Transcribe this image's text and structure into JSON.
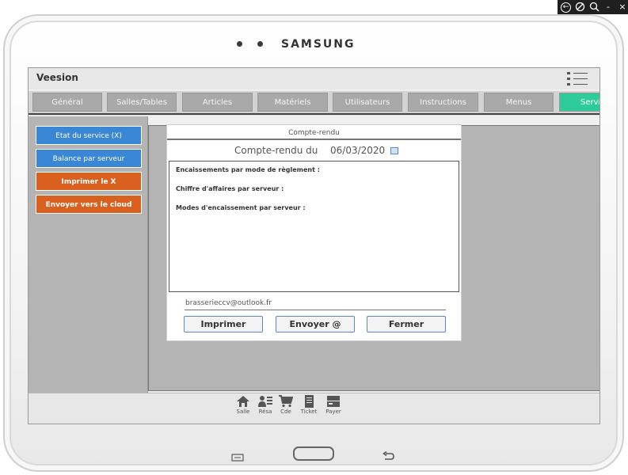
{
  "window_controls": [
    "back-icon",
    "rotate-icon",
    "zoom-icon",
    "minimize-icon",
    "close-icon"
  ],
  "window_controls_text": {
    "minimize": "-",
    "close": "×"
  },
  "device": {
    "brand": "SAMSUNG"
  },
  "app": {
    "title": "Veesion"
  },
  "tabs": [
    {
      "label": "Général",
      "active": false
    },
    {
      "label": "Salles/Tables",
      "active": false
    },
    {
      "label": "Articles",
      "active": false
    },
    {
      "label": "Matériels",
      "active": false
    },
    {
      "label": "Utilisateurs",
      "active": false
    },
    {
      "label": "Instructions",
      "active": false
    },
    {
      "label": "Menus",
      "active": false
    },
    {
      "label": "Servi",
      "active": true
    }
  ],
  "sidebar": {
    "buttons": [
      {
        "label": "Etat du service (X)",
        "style": "blue"
      },
      {
        "label": "Balance par serveur",
        "style": "blue"
      },
      {
        "label": "Imprimer le X",
        "style": "orange"
      },
      {
        "label": "Envoyer vers le cloud",
        "style": "orange"
      }
    ]
  },
  "dialog": {
    "title": "Compte-rendu",
    "label": "Compte-rendu du",
    "date": "06/03/2020",
    "report_lines": [
      "Encaissements par mode de règlement :",
      "Chiffre d'affaires par serveur :",
      "Modes d'encaissement  par serveur :"
    ],
    "email": "brasserieccv@outlook.fr",
    "buttons": {
      "print": "Imprimer",
      "send": "Envoyer @",
      "close": "Fermer"
    }
  },
  "bottom_nav": [
    {
      "label": "Salle",
      "icon": "home-icon"
    },
    {
      "label": "Résa",
      "icon": "reservation-icon"
    },
    {
      "label": "Cde",
      "icon": "cart-icon"
    },
    {
      "label": "Ticket",
      "icon": "ticket-icon"
    },
    {
      "label": "Payer",
      "icon": "payment-icon"
    }
  ],
  "colors": {
    "tab_active": "#2ecc9a",
    "button_blue": "#3a87d6",
    "button_orange": "#d9601f"
  }
}
